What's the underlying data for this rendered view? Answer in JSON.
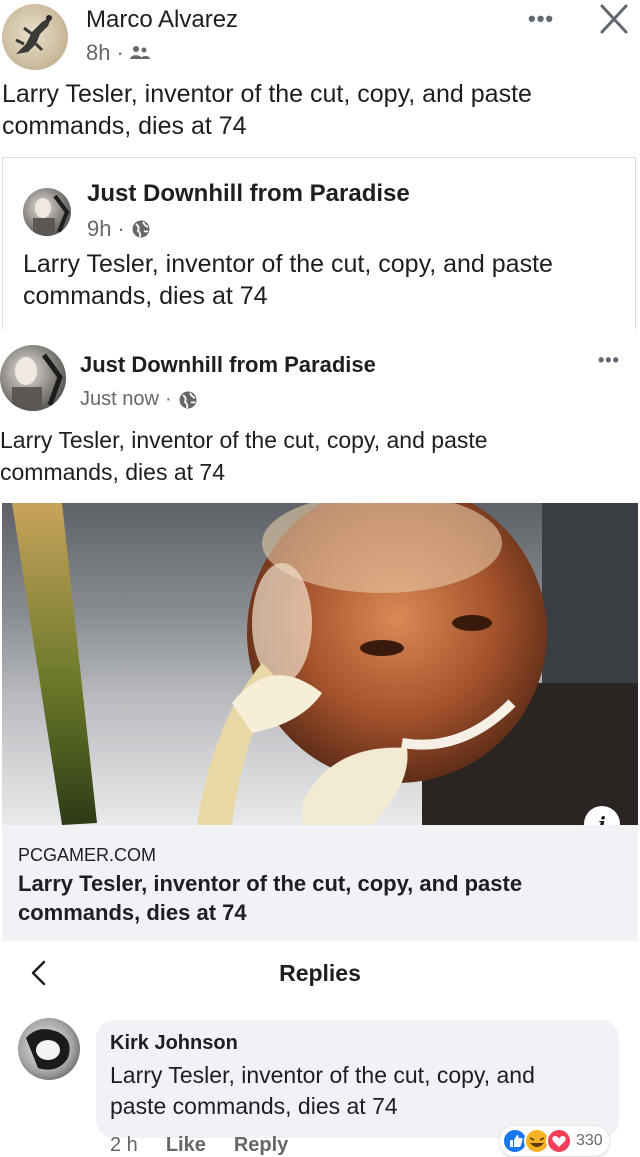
{
  "post": {
    "author": "Marco Alvarez",
    "time": "8h",
    "audience_icon": "friends-icon",
    "text": "Larry Tesler, inventor of the cut, copy, and paste commands, dies at 74",
    "more_label": "•••",
    "close_label": "✕"
  },
  "shared_post": {
    "author": "Just Downhill from Paradise",
    "time": "9h",
    "audience_icon": "globe-icon",
    "text": "Larry Tesler, inventor of the cut, copy, and paste commands, dies at 74"
  },
  "inner_post": {
    "author": "Just Downhill from Paradise",
    "time": "Just now",
    "audience_icon": "globe-icon",
    "text": "Larry Tesler, inventor of the cut, copy, and paste commands, dies at 74",
    "more_label": "•••"
  },
  "link_preview": {
    "domain": "PCGAMER.COM",
    "title": "Larry Tesler, inventor of the cut, copy, and paste commands, dies at 74",
    "info_label": "i"
  },
  "replies": {
    "back_label": "<",
    "title": "Replies",
    "comment": {
      "author": "Kirk Johnson",
      "text": "Larry Tesler, inventor of the cut, copy, and paste commands, dies at 74",
      "time": "2 h",
      "like_label": "Like",
      "reply_label": "Reply",
      "reaction_count": "330"
    }
  },
  "colors": {
    "like_blue": "#1877f2",
    "haha_yellow": "#f7b125",
    "love_red": "#f33e58"
  }
}
